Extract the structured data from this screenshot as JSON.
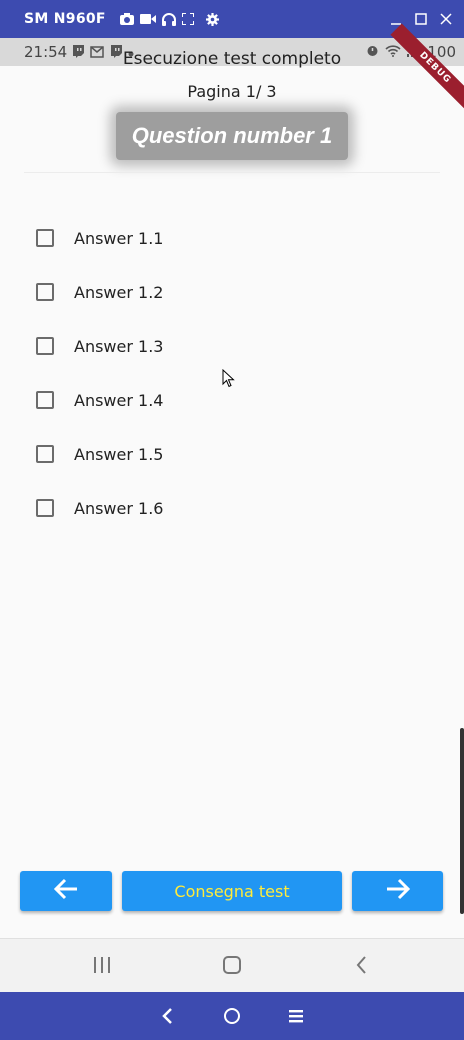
{
  "window": {
    "title": "SM N960F",
    "icons": [
      "camera-icon",
      "video-icon",
      "headphones-icon",
      "fullscreen-icon",
      "settings-icon"
    ],
    "controls": [
      "minimize-icon",
      "maximize-icon",
      "close-icon"
    ]
  },
  "status_bar": {
    "time": "21:54",
    "battery": "100"
  },
  "app": {
    "title": "Esecuzione test completo",
    "debug_banner": "DEBUG"
  },
  "quiz": {
    "page_indicator": "Pagina 1/ 3",
    "question": "Question number 1",
    "answers": [
      "Answer 1.1",
      "Answer 1.2",
      "Answer 1.3",
      "Answer 1.4",
      "Answer 1.5",
      "Answer 1.6"
    ],
    "answers_checked": [
      false,
      false,
      false,
      false,
      false,
      false
    ]
  },
  "actions": {
    "prev_icon": "arrow-left-icon",
    "submit_label": "Consegna test",
    "next_icon": "arrow-right-icon"
  },
  "colors": {
    "primary": "#2196f3",
    "submit_text": "#ffeb3b",
    "window_bar": "#3d4bb0",
    "debug_banner": "#9b1f2e"
  }
}
